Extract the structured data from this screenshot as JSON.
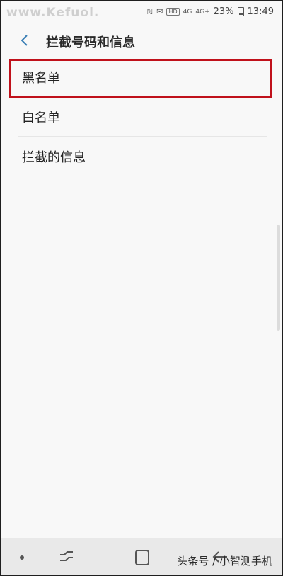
{
  "status_bar": {
    "carrier_watermark": "www.Kefuol.",
    "icons": [
      "network-icon",
      "hd-icon",
      "4g-signal-icon",
      "4g-signal-icon",
      "battery-icon"
    ],
    "battery_percent": "23%",
    "time": "13:49",
    "sym_1": "ℕ",
    "sym_2": "✉",
    "hd_label": "HD",
    "sig_1": "4G",
    "sig_2": "4G+"
  },
  "app_bar": {
    "title": "拦截号码和信息"
  },
  "list": {
    "items": [
      {
        "label": "黑名单"
      },
      {
        "label": "白名单"
      },
      {
        "label": "拦截的信息"
      }
    ]
  },
  "nav_bar": {
    "icons": [
      "dot-icon",
      "recent-apps-icon",
      "home-icon",
      "back-icon"
    ]
  },
  "watermark": "头条号 / 小智测手机",
  "colors": {
    "highlight": "#c0111b",
    "accent": "#3a7fb5",
    "background": "#f8f8f8"
  }
}
